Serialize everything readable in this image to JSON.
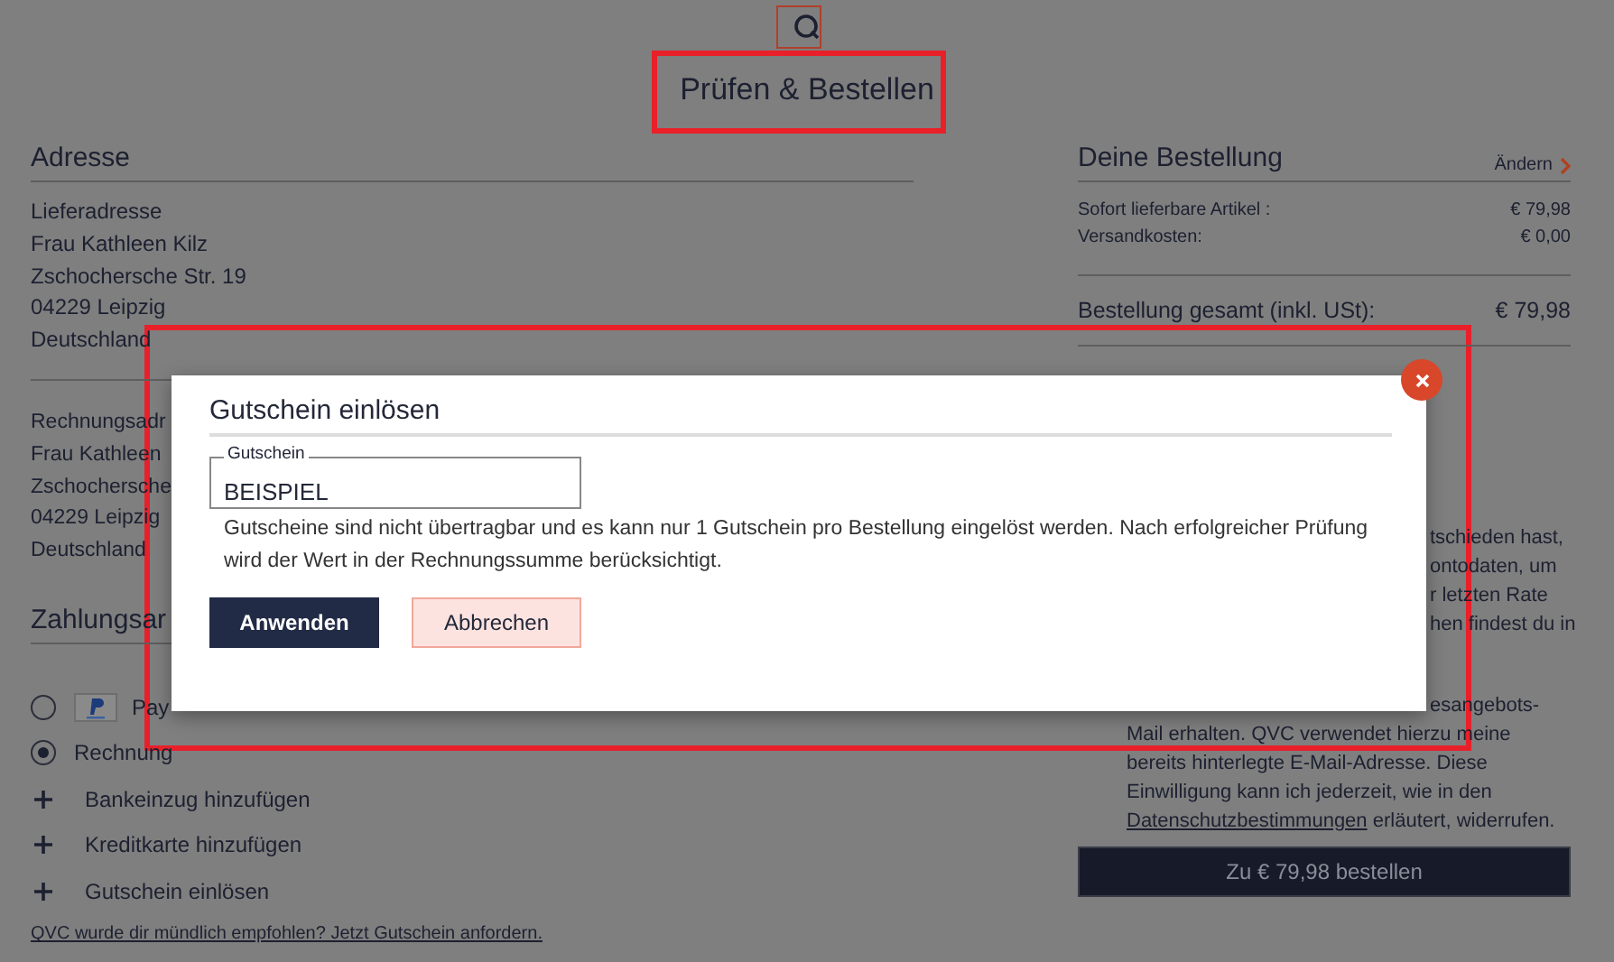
{
  "header": {
    "title": "Prüfen & Bestellen"
  },
  "address": {
    "heading": "Adresse",
    "delivery": [
      "Lieferadresse",
      "Frau Kathleen Kilz",
      "Zschochersche Str. 19",
      "04229 Leipzig",
      "Deutschland"
    ],
    "billing": [
      "Rechnungsadr",
      "Frau Kathleen",
      "Zschochersche",
      "04229 Leipzig",
      "Deutschland"
    ]
  },
  "payment": {
    "heading": "Zahlungsar",
    "methods": [
      {
        "label": "Pay",
        "kind": "paypal",
        "selected": false
      },
      {
        "label": "Rechnung",
        "kind": "plain",
        "selected": true
      }
    ],
    "add_options": [
      "Bankeinzug hinzufügen",
      "Kreditkarte hinzufügen",
      "Gutschein einlösen"
    ],
    "referral_link": "QVC wurde dir mündlich empfohlen? Jetzt Gutschein anfordern."
  },
  "order": {
    "heading": "Deine Bestellung",
    "edit_link": "Ändern",
    "items": [
      {
        "label": "Sofort lieferbare Artikel :",
        "value": "€ 79,98"
      },
      {
        "label": "Versandkosten:",
        "value": "€ 0,00"
      }
    ],
    "total": {
      "label": "Bestellung gesamt (inkl. USt):",
      "value": "€ 79,98"
    },
    "info_fragments": [
      "tschieden hast,",
      "ontodaten, um",
      "r letzten Rate",
      "hen findest du in"
    ],
    "consent_fragment": "esangebots-",
    "consent_lines": [
      "Mail erhalten. QVC verwendet hierzu meine",
      "bereits hinterlegte E-Mail-Adresse. Diese",
      "Einwilligung kann ich jederzeit, wie in den"
    ],
    "privacy_link": "Datenschutzbestimmungen",
    "privacy_suffix": "erläutert, widerrufen.",
    "submit": "Zu € 79,98 bestellen"
  },
  "dialog": {
    "title": "Gutschein einlösen",
    "field": {
      "label": "Gutschein",
      "value": "BEISPIEL"
    },
    "info": "Gutscheine sind nicht übertragbar und es kann nur 1 Gutschein pro Bestellung eingelöst werden. Nach erfolgreicher Prüfung wird der Wert in der Rechnungssumme berücksichtigt.",
    "buttons": [
      {
        "label": "Anwenden",
        "kind": "primary"
      },
      {
        "label": "Abbrechen",
        "kind": "secondary"
      }
    ]
  }
}
